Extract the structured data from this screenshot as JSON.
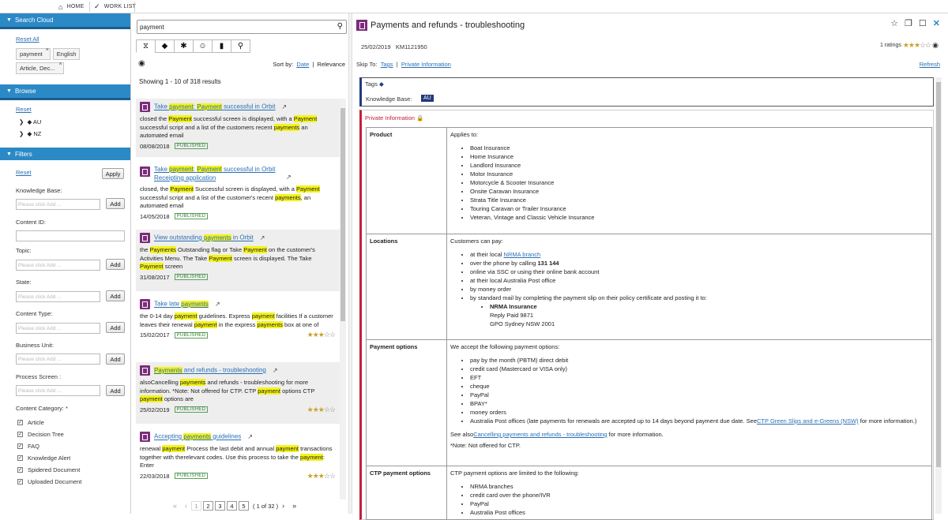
{
  "topbar": {
    "home": "HOME",
    "worklist": "WORK LIST"
  },
  "left": {
    "search_cloud": {
      "title": "Search Cloud",
      "reset": "Reset All",
      "chips": [
        "payment",
        "English",
        "Article, Dec..."
      ]
    },
    "browse": {
      "title": "Browse",
      "reset": "Reset",
      "items": [
        "AU",
        "NZ"
      ]
    },
    "filters": {
      "title": "Filters",
      "reset": "Reset",
      "apply": "Apply",
      "knowledge_base": "Knowledge Base:",
      "content_id": "Content ID:",
      "topic": "Topic:",
      "state": "State:",
      "content_type": "Content Type:",
      "business_unit": "Business Unit:",
      "process_screen": "Process Screen :",
      "placeholder": "Please click Add ...",
      "add": "Add",
      "content_category": "Content Category: *",
      "categories": [
        "Article",
        "Decision Tree",
        "FAQ",
        "Knowledge Alert",
        "Spidered Document",
        "Uploaded Document"
      ]
    }
  },
  "middle": {
    "search_value": "payment",
    "sort_by": "Sort by:",
    "sort_date": "Date",
    "sort_sep": "|",
    "sort_relevance": "Relevance",
    "showing": "Showing 1 - 10 of 318 results",
    "results": [
      {
        "t1": "Take ",
        "t2": "payment",
        "t3": ": ",
        "t4": "Payment",
        "t5": " successful in Orbit",
        "date": "08/08/2018",
        "status": "PUBLISHED"
      },
      {
        "t1": "Take ",
        "t2": "payment",
        "t3": ": ",
        "t4": "Payment",
        "t5": " successful in Orbit Receipting application",
        "date": "14/05/2018",
        "status": "PUBLISHED"
      },
      {
        "t1": "View outstanding ",
        "t2": "payments",
        "t3": " in Orbit",
        "date": "31/08/2017",
        "status": "PUBLISHED"
      },
      {
        "t1": "Take late ",
        "t2": "payments",
        "date": "15/02/2017",
        "status": "PUBLISHED"
      },
      {
        "t1": "Payments",
        "t2": " and refunds - troubleshooting",
        "date": "25/02/2019",
        "status": "PUBLISHED"
      },
      {
        "t1": "Accepting ",
        "t2": "payments",
        "t3": " guidelines",
        "date": "22/03/2018",
        "status": "PUBLISHED"
      }
    ],
    "bodies": {
      "r1": [
        "closed the ",
        "Payment",
        " successful screen is displayed, with a ",
        "Payment",
        " successful script and a list of the customers recent ",
        "payments",
        " an automated email"
      ],
      "r2": [
        "closed, the ",
        "Payment",
        " Successful screen is displayed, with a ",
        "Payment",
        " successful script and a list of the customer's recent ",
        "payments",
        ", an automated email"
      ],
      "r3": [
        "the ",
        "Payments",
        " Outstanding flag or Take ",
        "Payment",
        " on the customer's Activities Menu. The Take ",
        "Payment",
        " screen is displayed. The Take ",
        "Payment",
        " screen"
      ],
      "r4": [
        "the 0-14 day ",
        "payment",
        " guidelines. Express ",
        "payment",
        " facilities If a customer leaves their renewal ",
        "payment",
        " in the express ",
        "payments",
        " box at one of"
      ],
      "r5": [
        "alsoCancelling ",
        "payments",
        " and refunds - troubleshooting for more information. *Note: Not offered for CTP. CTP ",
        "payment",
        " options CTP ",
        "payment",
        " options are"
      ],
      "r6": [
        "renewal ",
        "payment",
        " Process the last debit and annual ",
        "payment",
        " transactions together with therelevant codes. Use this process to take the ",
        "payment",
        ": Enter"
      ]
    },
    "pager": {
      "pages": [
        "1",
        "2",
        "3",
        "4",
        "5"
      ],
      "info": "( 1 of 32 )"
    }
  },
  "article": {
    "title": "Payments and refunds - troubleshooting",
    "date": "25/02/2019",
    "id": "KM1121950",
    "ratings": "1 ratings",
    "skip_to": "Skip To:",
    "skip_tags": "Tags",
    "skip_sep": "|",
    "skip_private": "Private Information",
    "refresh": "Refresh",
    "tags_label": "Tags",
    "kb_label": "Knowledge Base:",
    "kb_value": "AU",
    "private_label": "Private Information",
    "product": {
      "head": "Product",
      "intro": "Applies to:",
      "items": [
        "Boat Insurance",
        "Home Insurance",
        "Landlord Insurance",
        "Motor Insurance",
        "Motorcycle & Scooter Insurance",
        "Onsite Caravan Insurance",
        "Strata Title Insurance",
        "Touring Caravan or Trailer Insurance",
        "Veteran, Vintage and Classic Vehicle Insurance"
      ]
    },
    "locations": {
      "head": "Locations",
      "intro": "Customers can pay:",
      "i1a": "at their local ",
      "i1b": "NRMA branch",
      "i2a": "over the phone by calling ",
      "i2b": "131 144",
      "i3": "online via SSC or using their online bank account",
      "i4": "at their local Australia Post office",
      "i5": "by money order",
      "i6": "by standard mail by completing the payment slip on their policy certificate and posting it to:",
      "addr1": "NRMA Insurance",
      "addr2": "Reply Paid 9871",
      "addr3": "GPO Sydney NSW 2001"
    },
    "payment": {
      "head": "Payment options",
      "intro": "We accept the following payment options:",
      "items": [
        "pay by the month (PBTM) direct debit",
        "credit card (Mastercard or VISA only)",
        "EFT",
        "cheque",
        "PayPal",
        "BPAY*",
        "money orders"
      ],
      "last_a": "Australia Post offices (late payments for renewals are accepted up to 14 days beyond payment due date. See",
      "last_b": "CTP Green Slips and e-Greens (NSW)",
      "last_c": " for more information.)",
      "see_a": "See also",
      "see_b": "Cancelling payments and refunds - troubleshooting",
      "see_c": " for more information.",
      "note": "*Note: Not offered for CTP."
    },
    "ctp": {
      "head": "CTP payment options",
      "intro": "CTP payment options are limited to the following:",
      "items": [
        "NRMA branches",
        "credit card over the phone/IVR",
        "PayPal",
        "Australia Post offices"
      ]
    }
  },
  "colors": {
    "accent": "#2b89c6",
    "doc": "#7b2d7b",
    "highlight": "#f3f31a",
    "private": "#c4203a",
    "kb": "#223a7a"
  }
}
